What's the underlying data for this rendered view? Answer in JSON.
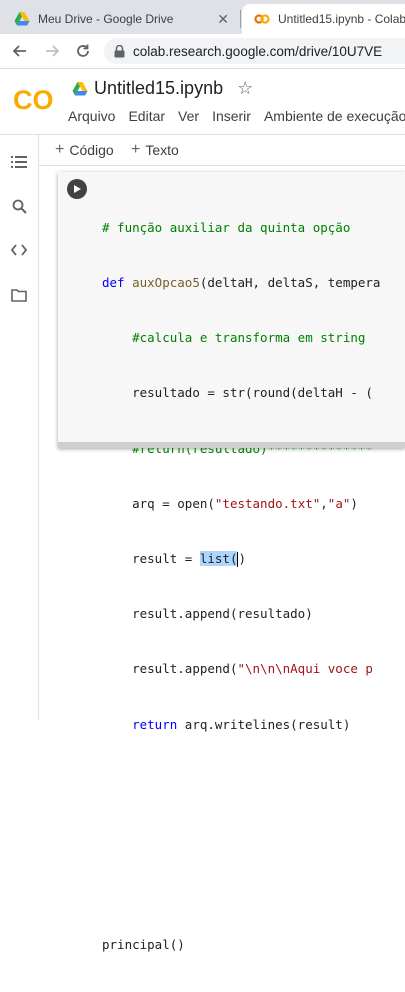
{
  "browser": {
    "tabs": [
      {
        "title": "Meu Drive - Google Drive",
        "close": "✕"
      },
      {
        "title": "Untitled15.ipynb - Colab"
      }
    ],
    "url": "colab.research.google.com/drive/10U7VE"
  },
  "colab": {
    "logo_text": "CO",
    "notebook_title": "Untitled15.ipynb",
    "menu": [
      "Arquivo",
      "Editar",
      "Ver",
      "Inserir",
      "Ambiente de execução"
    ],
    "toolbar": {
      "code_label": "Código",
      "text_label": "Texto"
    },
    "sidebar_icons": [
      "table-of-contents-icon",
      "search-icon",
      "code-snippets-icon",
      "files-icon"
    ]
  },
  "code_lines": {
    "l1": "# função auxiliar da quinta opção",
    "l2_kw": "def",
    "l2_fn": "auxOpcao5",
    "l2_rest": "(deltaH, deltaS, tempera",
    "l3": "#calcula e transforma em string",
    "l4": "resultado = str(round(deltaH - (",
    "l5": "#return(resultado)**************",
    "l6a": "arq = open(",
    "l6s1": "\"testando.txt\"",
    "l6b": ",",
    "l6s2": "\"a\"",
    "l6c": ")",
    "l7a": "result = ",
    "l7sel": "list(",
    "l7b": ")",
    "l8": "result.append(resultado)",
    "l9a": "result.append(",
    "l9s": "\"\\n\\n\\nAqui voce p",
    "l10kw": "return",
    "l10rest": " arq.writelines(result)",
    "l14": "principal()"
  },
  "colors": {
    "accent": "#f9ab00",
    "keyword": "#0000ff",
    "comment": "#008000",
    "string": "#a31515"
  }
}
